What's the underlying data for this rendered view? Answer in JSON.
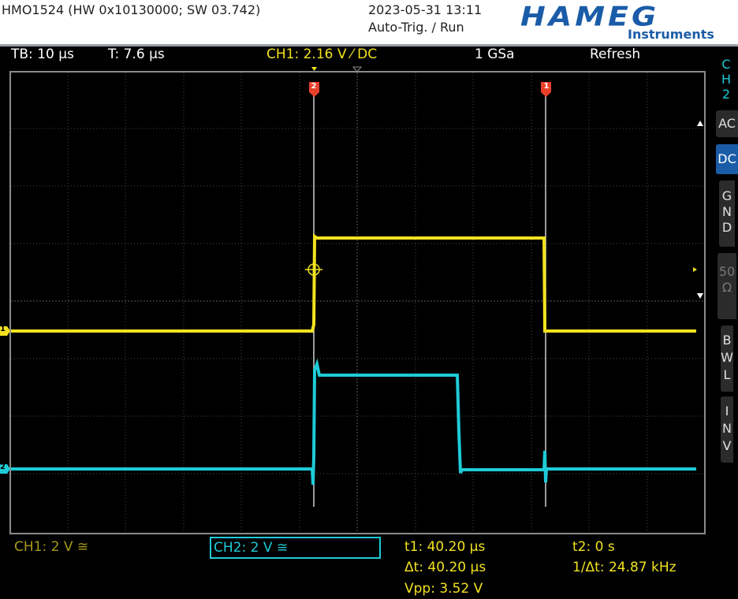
{
  "title_bar": {
    "device": "HMO1524 (HW 0x10130000; SW 03.742)",
    "datetime": "2023-05-31 13:11",
    "trigger_status": "Auto-Trig. / Run",
    "logo": "HAMEG",
    "logo_sub": "Instruments"
  },
  "status": {
    "timebase": "TB: 10 µs",
    "trigger_time": "T: 7.6 µs",
    "ch1_trigger": "CH1: 2.16 V ⁄ DC",
    "sample_rate": "1 GSa",
    "mode": "Refresh"
  },
  "sidebar": {
    "channel_label": [
      "C",
      "H",
      "2"
    ],
    "buttons": [
      {
        "label": "AC",
        "active": false
      },
      {
        "label": "DC",
        "active": true
      },
      {
        "label": "GND",
        "active": false
      },
      {
        "label": "50Ω",
        "active": false
      },
      {
        "label": "BWL",
        "active": false
      },
      {
        "label": "INV",
        "active": false
      }
    ]
  },
  "channels": {
    "ch1": {
      "label": "CH1: 2 V ≅",
      "color": "#f2e21e"
    },
    "ch2": {
      "label": "CH2: 2 V ≅",
      "color": "#1ecbd8"
    }
  },
  "cursors": {
    "cursor1_label": "1",
    "cursor2_label": "2",
    "t1": "t1: 40.20 µs",
    "t2": "t2: 0 s",
    "delta_t": "Δt: 40.20 µs",
    "inv_delta_t": "1/Δt: 24.87 kHz",
    "vpp": "Vpp: 3.52 V"
  },
  "markers": {
    "ch1_ground": "1",
    "ch2_ground": "2"
  },
  "colors": {
    "ch1": "#f2e21e",
    "ch2": "#1ecbd8",
    "cursor": "#d8d8d8",
    "cursor_flag": "#e8402a",
    "grid": "#5a5a5a",
    "active_button": "#1a5ca8"
  }
}
